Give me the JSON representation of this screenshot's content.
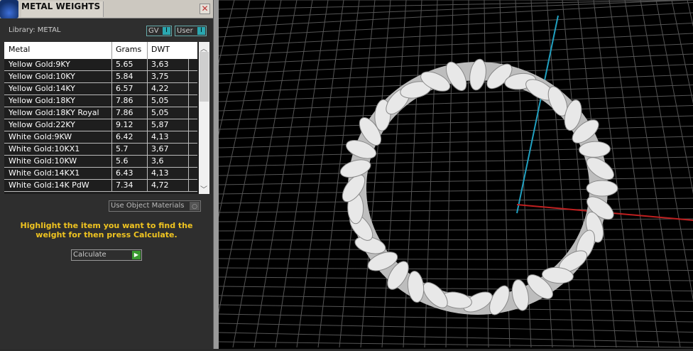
{
  "panel": {
    "title": "METAL WEIGHTS",
    "close": "✕",
    "library": "Library: METAL",
    "toggles": [
      {
        "label": "GV",
        "state": "I"
      },
      {
        "label": "User",
        "state": "I"
      }
    ],
    "columns": [
      "Metal",
      "Grams",
      "DWT"
    ],
    "rows": [
      {
        "metal": "Yellow Gold:9KY",
        "grams": "5.65",
        "dwt": "3,63"
      },
      {
        "metal": "Yellow Gold:10KY",
        "grams": "5.84",
        "dwt": "3,75"
      },
      {
        "metal": "Yellow Gold:14KY",
        "grams": "6.57",
        "dwt": "4,22"
      },
      {
        "metal": "Yellow Gold:18KY",
        "grams": "7.86",
        "dwt": "5,05"
      },
      {
        "metal": "Yellow Gold:18KY Royal",
        "grams": "7.86",
        "dwt": "5,05"
      },
      {
        "metal": "Yellow Gold:22KY",
        "grams": "9.12",
        "dwt": "5,87"
      },
      {
        "metal": "White Gold:9KW",
        "grams": "6.42",
        "dwt": "4,13"
      },
      {
        "metal": "White Gold:10KX1",
        "grams": "5.7",
        "dwt": "3,67"
      },
      {
        "metal": "White Gold:10KW",
        "grams": "5.6",
        "dwt": "3,6"
      },
      {
        "metal": "White Gold:14KX1",
        "grams": "6.43",
        "dwt": "4,13"
      },
      {
        "metal": "White Gold:14K PdW",
        "grams": "7.34",
        "dwt": "4,72"
      }
    ],
    "use_object_materials": "Use Object Materials",
    "hint": "Highlight the item you want to find the weight for then press Calculate.",
    "calculate": "Calculate"
  },
  "colors": {
    "hint": "#f0c420",
    "accent": "#2aa7b0",
    "axis_x": "#c02020",
    "axis_y": "#20a0c0"
  }
}
